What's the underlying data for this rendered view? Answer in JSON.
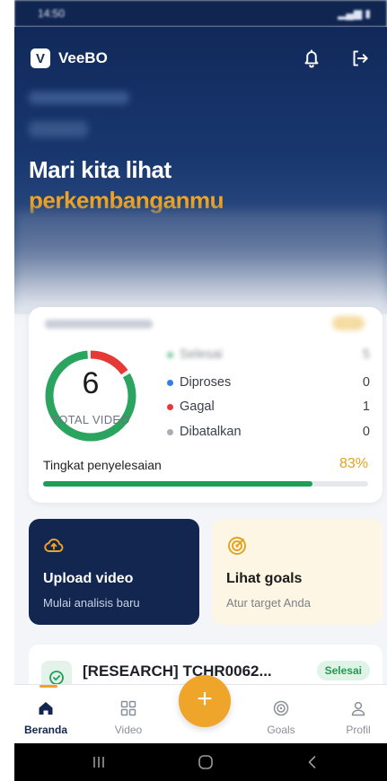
{
  "status_bar": {
    "time": "14:50",
    "system_icons": "signal-wifi-battery-icons"
  },
  "header": {
    "logo_letter": "V",
    "app_name": "VeeBO",
    "icons": [
      "bell-icon",
      "logout-icon"
    ]
  },
  "hero": {
    "title_line1": "Mari kita lihat",
    "title_line2": "perkembanganmu"
  },
  "stats": {
    "total": "6",
    "total_label": "TOTAL VIDEO",
    "legend": [
      {
        "label": "Selesai",
        "value": "5",
        "color": "#2aa45f"
      },
      {
        "label": "Diproses",
        "value": "0",
        "color": "#2f80ed"
      },
      {
        "label": "Gagal",
        "value": "1",
        "color": "#e53935"
      },
      {
        "label": "Dibatalkan",
        "value": "0",
        "color": "#a8adb8"
      }
    ],
    "completion_label": "Tingkat penyelesaian",
    "completion_value": "83%",
    "completion_fraction": 0.83
  },
  "actions": {
    "upload": {
      "title": "Upload video",
      "subtitle": "Mulai analisis baru",
      "icon": "cloud-upload-icon"
    },
    "goals": {
      "title": "Lihat goals",
      "subtitle": "Atur target Anda",
      "icon": "target-icon"
    }
  },
  "recent": {
    "title": "[RESEARCH] TCHR0062...",
    "status": "Selesai",
    "icon": "check-circle-icon"
  },
  "bottom_nav": {
    "items": [
      {
        "label": "Beranda",
        "icon": "home-icon"
      },
      {
        "label": "Video",
        "icon": "grid-icon"
      },
      {
        "label": "Goals",
        "icon": "target-icon"
      },
      {
        "label": "Profil",
        "icon": "user-icon"
      }
    ],
    "fab_label": "+"
  },
  "colors": {
    "navy": "#12264f",
    "accent": "#f0a522",
    "success": "#1f9e57",
    "danger": "#e53935"
  }
}
